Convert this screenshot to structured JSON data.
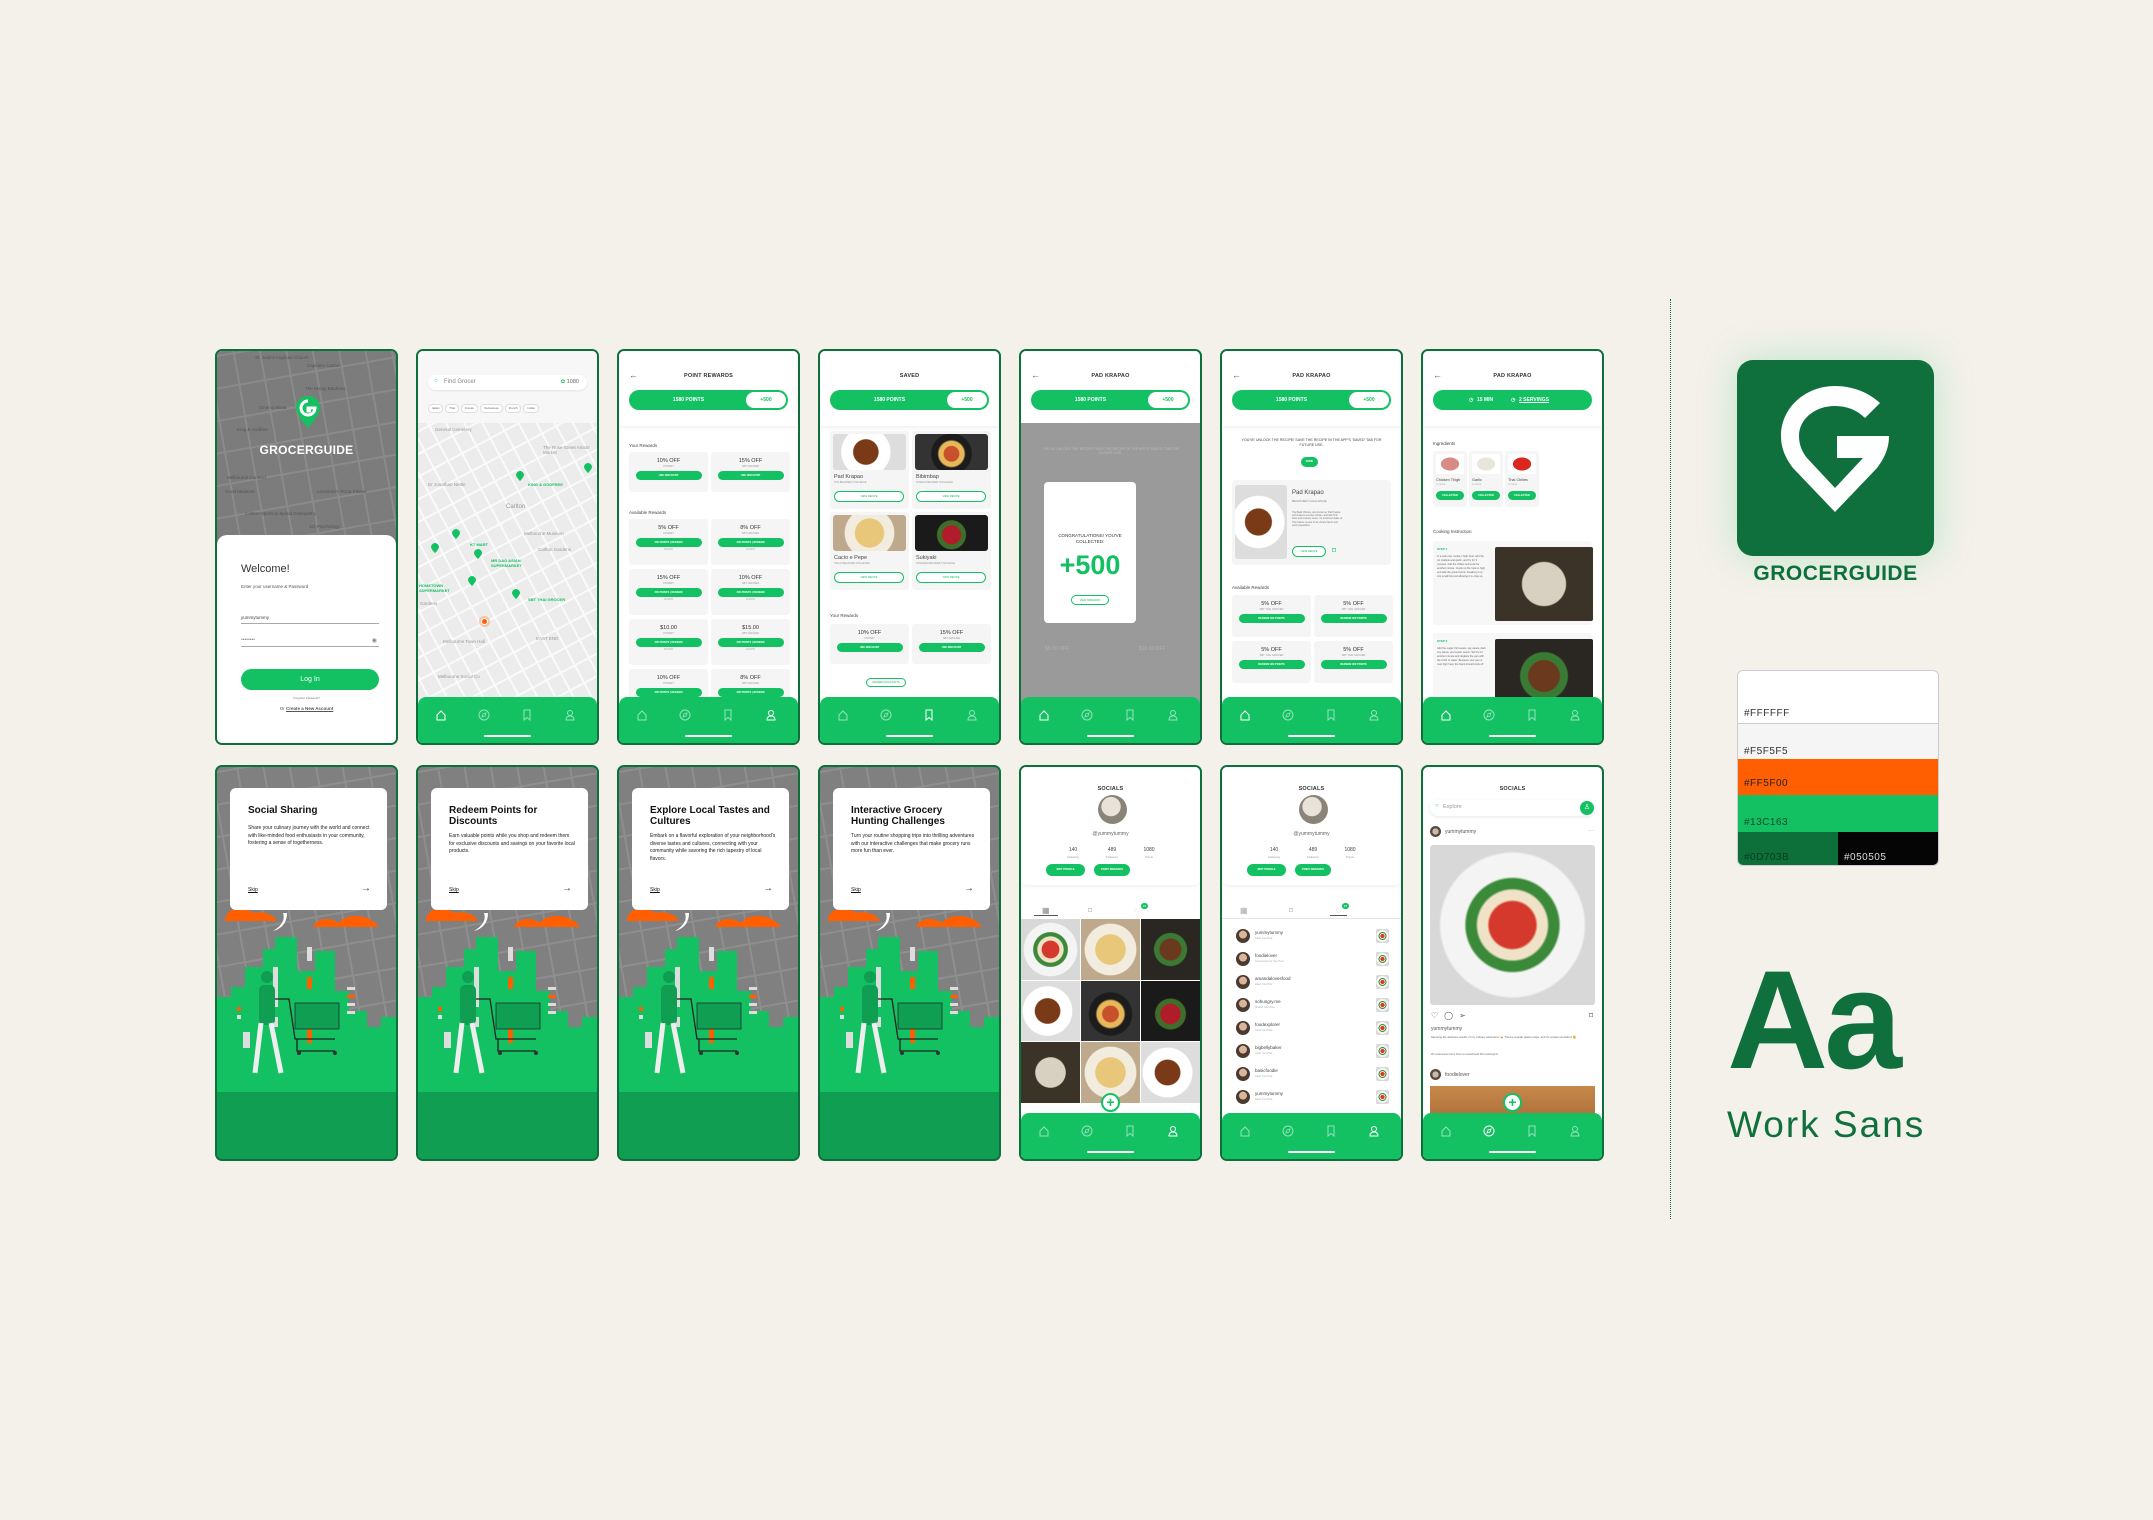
{
  "brand": {
    "name": "GROCERGUIDE",
    "colors": {
      "primary": "#13C163",
      "dark": "#0D703B",
      "accent": "#FF5F00",
      "background": "#F5F5F5",
      "white": "#FFFFFF",
      "black": "#050505"
    }
  },
  "nav_icons": [
    "home-icon",
    "compass-icon",
    "bookmark-icon",
    "user-icon"
  ],
  "login": {
    "logo_text": "GROCERGUIDE",
    "welcome": "Welcome!",
    "subtitle": "Enter your username & Password",
    "username_value": "yummytummy",
    "password_value": "••••••••",
    "login_button": "Log In",
    "forgot": "Forgotten Password?",
    "create_prefix": "Or",
    "create_link": "Create a New Account",
    "map_labels": [
      "St. Jude's Anglican Church",
      "Capitano Carlton",
      "The Moray Bauhaus",
      "Cinema Nova",
      "King & Godfree",
      "Melbourne Connect",
      "Good Measure",
      "Leonardo's Pizza Palace",
      "Carlton Sports & Spinal Osteopathy",
      "SO Psychology"
    ]
  },
  "map_screen": {
    "search_placeholder": "Find Grocer",
    "points": "1080",
    "chips": [
      "Italian",
      "Thai",
      "Korean",
      "Vietnamese",
      "French",
      "Indian"
    ],
    "map_labels": [
      "General Cemetery",
      "The Rose Street Artists' Market",
      "Dr Jonathan Nettle",
      "Carlton",
      "Melbourne Museum",
      "Carlton Gardens",
      "Gardens",
      "Melbourne Town Hall",
      "EAST END",
      "Melbourne Social Co"
    ],
    "stores": [
      "KING & GODFREE",
      "KT MART",
      "MR DAO ASIAN SUPERMARKET",
      "HOMETOWN SUPERMARKET",
      "SBT THAI GROCER"
    ]
  },
  "points_bar": {
    "points": "1580 POINTS",
    "bonus": "+500"
  },
  "rewards_screen": {
    "title": "POINT REWARDS",
    "your_rewards_label": "Your Rewards",
    "your_rewards": [
      {
        "title": "10% OFF",
        "store": "KTMART",
        "button": "USE DISCOUNT"
      },
      {
        "title": "15% OFF",
        "store": "SBT GROCER",
        "button": "USE DISCOUNT"
      }
    ],
    "available_label": "Available Rewards",
    "available": [
      {
        "title": "5% OFF",
        "store": "KTMART",
        "button": "300 POINTS | REDEEM",
        "expiry": "01/02/25"
      },
      {
        "title": "8% OFF",
        "store": "SBT GROCER",
        "button": "300 POINTS | REDEEM",
        "expiry": "01/02/25"
      },
      {
        "title": "15% OFF",
        "store": "KTMART",
        "button": "300 POINTS | REDEEM",
        "expiry": "01/02/25"
      },
      {
        "title": "10% OFF",
        "store": "SBT GROCER",
        "button": "300 POINTS | REDEEM",
        "expiry": "01/02/25"
      },
      {
        "title": "$10.00",
        "store": "KTMART",
        "button": "300 POINTS | REDEEM",
        "expiry": "01/02/25"
      },
      {
        "title": "$15.00",
        "store": "SBT GROCER",
        "button": "300 POINTS | REDEEM",
        "expiry": "01/02/25"
      },
      {
        "title": "10% OFF",
        "store": "KTMART",
        "button": "300 POINTS | REDEEM"
      },
      {
        "title": "8% OFF",
        "store": "SBT GROCER",
        "button": "300 POINTS | REDEEM"
      }
    ]
  },
  "saved_screen": {
    "title": "SAVED",
    "recipes": [
      {
        "name": "Pad Krapao",
        "challenge": "THAI BEGINNER CHALLENGE",
        "button": "VIEW RECIPE"
      },
      {
        "name": "Bibimbap",
        "challenge": "KOREAN BEGINNER CHALLENGE",
        "button": "VIEW RECIPE"
      },
      {
        "name": "Cacio e Pepe",
        "challenge": "ITALIAN BEGINNER CHALLENGE",
        "button": "VIEW RECIPE"
      },
      {
        "name": "Sukiyaki",
        "challenge": "JAPANESE BEGINNER CHALLENGE",
        "button": "VIEW RECIPE"
      }
    ],
    "your_rewards_label": "Your Rewards",
    "your_rewards": [
      {
        "title": "10% OFF",
        "store": "KTMART",
        "button": "USE DISCOUNT"
      },
      {
        "title": "15% OFF",
        "store": "SBT GROCER",
        "button": "USE DISCOUNT"
      }
    ],
    "redeem_button": "REDEEM DISCOUNTS"
  },
  "congrats_screen": {
    "title": "PAD KRAPAO",
    "unlock_text": "YOU'VE UNLOCK THE RECIPE! SAVE THE RECIPE IN THE APP'S 'SAVED' TAB FOR FUTURE USE.",
    "modal_heading": "CONGRATULATIONS! YOU'VE COLLECTED:",
    "modal_points": "+500",
    "modal_button": "VIEW REWARDS",
    "bg_rewards": [
      "$5.00 OFF",
      "$10.00 OFF"
    ]
  },
  "unlocked_screen": {
    "title": "PAD KRAPAO",
    "unlock_text": "YOU'VE UNLOCK THE RECIPE! SAVE THE RECIPE IN THE APP'S 'SAVED' TAB FOR FUTURE USE.",
    "done_button": "DONE",
    "recipe_name": "Pad Krapao",
    "recipe_challenge": "BEGINNER CHALLENGE",
    "recipe_desc": "Thai Basil Chicken, also known as 'Pad Krapow Gai' features a tender chicken, aromatic Thai basil, and a savory sauce. It's a beloved staple of Thai cuisine, known for its vibrant flavors and quick preparation.",
    "view_button": "VIEW RECIPE",
    "available_label": "Available Rewards",
    "rewards": [
      {
        "title": "5% OFF",
        "store": "SBT THAI GROCER",
        "button": "REDEEM 300 POINTS"
      },
      {
        "title": "5% OFF",
        "store": "SBT THAI GROCER",
        "button": "REDEEM 300 POINTS"
      },
      {
        "title": "5% OFF",
        "store": "SBT THAI GROCER",
        "button": "REDEEM 300 POINTS"
      },
      {
        "title": "5% OFF",
        "store": "SBT THAI GROCER",
        "button": "REDEEM 300 POINTS"
      }
    ]
  },
  "recipe_screen": {
    "title": "PAD KRAPAO",
    "time": "15 MIN",
    "servings": "2 SERVINGS",
    "ingredients_label": "Ingredients",
    "ingredients": [
      {
        "name": "Chicken Thigh",
        "points": "5 POINTS",
        "button": "COLLECTED"
      },
      {
        "name": "Garlic",
        "points": "5 POINTS",
        "button": "COLLECTED"
      },
      {
        "name": "Thai Chilies",
        "points": "5 POINTS",
        "button": "COLLECTED"
      }
    ],
    "instruction_label": "Cooking Instruction",
    "steps": [
      {
        "label": "STEP 1",
        "text": "In a wok over medium high heat, add the oil, shallots and garlic, and fry for 3 minutes. Add the chilies and cook for another minute. Crank up the heat to high, and add the ground pork, breaking it up into small bits and allowing it to crisp up."
      },
      {
        "label": "STEP 2",
        "text": "Add the sugar, fish sauce, soy sauce, dark soy sauce, and oyster sauce. Stir-fry for another minute and deglaze the pan with the broth or water. Because your pan is over high heat, the liquid should cook off"
      }
    ]
  },
  "onboarding": [
    {
      "title": "Social Sharing",
      "body": "Share your culinary journey with the world and connect with like-minded food enthusiasts in your community, fostering a sense of togetherness.",
      "skip": "Skip"
    },
    {
      "title": "Redeem Points for Discounts",
      "body": "Earn valuable points while you shop and redeem them for exclusive discounts and savings on your favorite local products.",
      "skip": "Skip"
    },
    {
      "title": "Explore Local Tastes and Cultures",
      "body": "Embark on a flavorful exploration of your neighborhood's diverse tastes and cultures, connecting with your community while savoring the rich tapestry of local flavors.",
      "skip": "Skip"
    },
    {
      "title": "Interactive Grocery Hunting Challenges",
      "body": "Turn your routine shopping trips into thrilling adventures with our interactive challenges that make grocery runs more fun than ever.",
      "skip": "Skip"
    }
  ],
  "profile": {
    "title": "SOCIALS",
    "handle": "@yummytummy",
    "stats": [
      {
        "value": "140",
        "label": "Following"
      },
      {
        "value": "489",
        "label": "Followers"
      },
      {
        "value": "1080",
        "label": "Points"
      }
    ],
    "edit_button": "EDIT PROFILE",
    "rewards_button": "POINT REWARDS",
    "notif_badge": "15"
  },
  "notifications": [
    {
      "user": "yummytummy",
      "action": "Liked Your Post"
    },
    {
      "user": "foodielover",
      "action": "Commented on Your Post"
    },
    {
      "user": "amandalovesfood",
      "action": "Liked Your Post"
    },
    {
      "user": "sohungry.me",
      "action": "Shared Your Post"
    },
    {
      "user": "foodexplorer",
      "action": "Liked Your Post"
    },
    {
      "user": "bigbellybaker",
      "action": "Liked Your Post"
    },
    {
      "user": "basicfoodie",
      "action": "Liked Your Post"
    },
    {
      "user": "yummytummy",
      "action": "Liked Your Post"
    }
  ],
  "feed": {
    "title": "SOCIALS",
    "search_placeholder": "Explore",
    "post_user": "yummytummy",
    "caption_user": "yummytummy",
    "caption": "Savoring the delicious results of my culinary adventure! 🍝 Tried a popular pasta recipe, and it's a taste sensation! 😋",
    "hashtags": "#FoodieAdventures #HomemadePasta #FoodDelights",
    "next_user": "foodielover"
  },
  "style_guide": {
    "logo_text": "GROCERGUIDE",
    "palette": [
      "#FFFFFF",
      "#F5F5F5",
      "#FF5F00",
      "#13C163",
      "#0D703B",
      "#050505"
    ],
    "type_sample": "Aa",
    "font_name": "Work Sans"
  }
}
